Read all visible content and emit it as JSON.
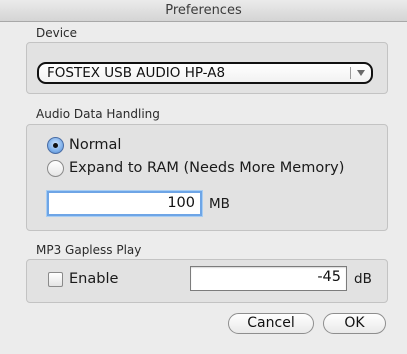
{
  "window": {
    "title": "Preferences"
  },
  "device": {
    "section_label": "Device",
    "selected": "FOSTEX USB AUDIO HP-A8"
  },
  "audio": {
    "section_label": "Audio Data Handling",
    "options": [
      {
        "label": "Normal",
        "checked": true
      },
      {
        "label": "Expand to RAM (Needs More Memory)",
        "checked": false
      }
    ],
    "ram_value": "100",
    "ram_unit": "MB"
  },
  "mp3": {
    "section_label": "MP3 Gapless Play",
    "enable_label": "Enable",
    "enable_checked": false,
    "value": "-45",
    "unit": "dB"
  },
  "buttons": {
    "cancel": "Cancel",
    "ok": "OK"
  },
  "colors": {
    "focus_ring": "#6ea5e6",
    "radio_selected": "#7fb0ea",
    "window_bg": "#ececec"
  },
  "icons": {
    "popup": "chevron-down-icon"
  }
}
